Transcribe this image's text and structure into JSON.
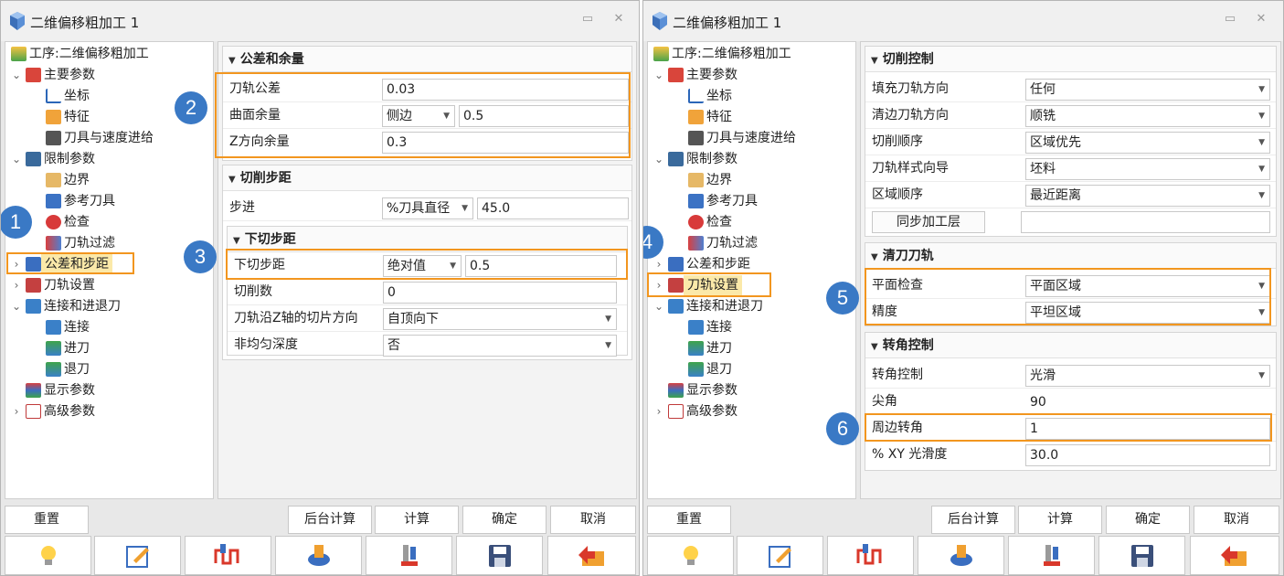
{
  "left": {
    "title": "二维偏移粗加工 1",
    "tree": [
      "工序:二维偏移粗加工",
      "主要参数",
      "坐标",
      "特征",
      "刀具与速度进给",
      "限制参数",
      "边界",
      "参考刀具",
      "检查",
      "刀轨过滤",
      "公差和步距",
      "刀轨设置",
      "连接和进退刀",
      "连接",
      "进刀",
      "退刀",
      "显示参数",
      "高级参数"
    ],
    "sections": {
      "tolerance": {
        "title": "公差和余量",
        "path_tol_label": "刀轨公差",
        "path_tol_value": "0.03",
        "surface_label": "曲面余量",
        "surface_mode": "侧边",
        "surface_value": "0.5",
        "z_label": "Z方向余量",
        "z_value": "0.3"
      },
      "stepover": {
        "title": "切削步距",
        "step_label": "步进",
        "step_mode": "%刀具直径",
        "step_value": "45.0"
      },
      "stepdown": {
        "title": "下切步距",
        "down_label": "下切步距",
        "down_mode": "绝对值",
        "down_value": "0.5",
        "cuts_label": "切削数",
        "cuts_value": "0",
        "dir_label": "刀轨沿Z轴的切片方向",
        "dir_value": "自顶向下",
        "nonuni_label": "非均匀深度",
        "nonuni_value": "否"
      }
    },
    "badges": [
      "1",
      "2",
      "3"
    ]
  },
  "right": {
    "title": "二维偏移粗加工 1",
    "tree": [
      "工序:二维偏移粗加工",
      "主要参数",
      "坐标",
      "特征",
      "刀具与速度进给",
      "限制参数",
      "边界",
      "参考刀具",
      "检查",
      "刀轨过滤",
      "公差和步距",
      "刀轨设置",
      "连接和进退刀",
      "连接",
      "进刀",
      "退刀",
      "显示参数",
      "高级参数"
    ],
    "sections": {
      "cut": {
        "title": "切削控制",
        "fill_label": "填充刀轨方向",
        "fill_value": "任何",
        "clean_label": "清边刀轨方向",
        "clean_value": "顺铣",
        "order_label": "切削顺序",
        "order_value": "区域优先",
        "style_label": "刀轨样式向导",
        "style_value": "坯料",
        "region_label": "区域顺序",
        "region_value": "最近距离",
        "sync_label": "同步加工层",
        "sync_value": ""
      },
      "clean": {
        "title": "清刀刀轨",
        "flat_label": "平面检查",
        "flat_value": "平面区域",
        "prec_label": "精度",
        "prec_value": "平坦区域"
      },
      "corner": {
        "title": "转角控制",
        "ctrl_label": "转角控制",
        "ctrl_value": "光滑",
        "sharp_label": "尖角",
        "sharp_value": "90",
        "peri_label": "周边转角",
        "peri_value": "1",
        "smooth_label": "% XY 光滑度",
        "smooth_value": "30.0"
      }
    },
    "badges": [
      "4",
      "5",
      "6"
    ]
  },
  "buttons": {
    "reset": "重置",
    "background": "后台计算",
    "compute": "计算",
    "ok": "确定",
    "cancel": "取消"
  },
  "icon_names": [
    "tip-bulb-icon",
    "edit-icon",
    "toolpath-preview-icon",
    "tool-icon",
    "simulate-icon",
    "save-icon",
    "import-icon"
  ],
  "colors": {
    "highlight": "#f2961f",
    "badge": "#3a79c5",
    "selected": "#fbe9a9"
  }
}
